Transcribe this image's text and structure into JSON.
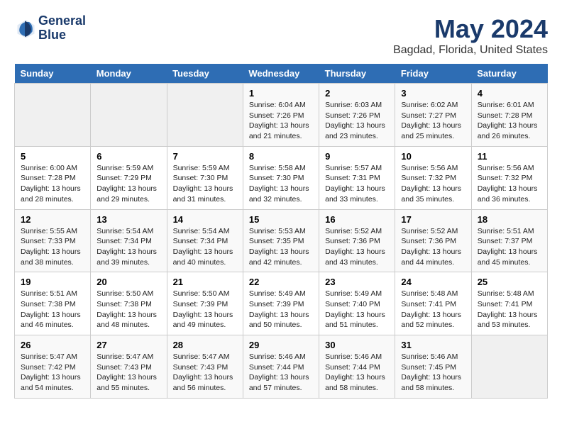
{
  "header": {
    "logo_line1": "General",
    "logo_line2": "Blue",
    "title": "May 2024",
    "subtitle": "Bagdad, Florida, United States"
  },
  "calendar": {
    "days_of_week": [
      "Sunday",
      "Monday",
      "Tuesday",
      "Wednesday",
      "Thursday",
      "Friday",
      "Saturday"
    ],
    "weeks": [
      [
        {
          "day": "",
          "info": ""
        },
        {
          "day": "",
          "info": ""
        },
        {
          "day": "",
          "info": ""
        },
        {
          "day": "1",
          "info": "Sunrise: 6:04 AM\nSunset: 7:26 PM\nDaylight: 13 hours\nand 21 minutes."
        },
        {
          "day": "2",
          "info": "Sunrise: 6:03 AM\nSunset: 7:26 PM\nDaylight: 13 hours\nand 23 minutes."
        },
        {
          "day": "3",
          "info": "Sunrise: 6:02 AM\nSunset: 7:27 PM\nDaylight: 13 hours\nand 25 minutes."
        },
        {
          "day": "4",
          "info": "Sunrise: 6:01 AM\nSunset: 7:28 PM\nDaylight: 13 hours\nand 26 minutes."
        }
      ],
      [
        {
          "day": "5",
          "info": "Sunrise: 6:00 AM\nSunset: 7:28 PM\nDaylight: 13 hours\nand 28 minutes."
        },
        {
          "day": "6",
          "info": "Sunrise: 5:59 AM\nSunset: 7:29 PM\nDaylight: 13 hours\nand 29 minutes."
        },
        {
          "day": "7",
          "info": "Sunrise: 5:59 AM\nSunset: 7:30 PM\nDaylight: 13 hours\nand 31 minutes."
        },
        {
          "day": "8",
          "info": "Sunrise: 5:58 AM\nSunset: 7:30 PM\nDaylight: 13 hours\nand 32 minutes."
        },
        {
          "day": "9",
          "info": "Sunrise: 5:57 AM\nSunset: 7:31 PM\nDaylight: 13 hours\nand 33 minutes."
        },
        {
          "day": "10",
          "info": "Sunrise: 5:56 AM\nSunset: 7:32 PM\nDaylight: 13 hours\nand 35 minutes."
        },
        {
          "day": "11",
          "info": "Sunrise: 5:56 AM\nSunset: 7:32 PM\nDaylight: 13 hours\nand 36 minutes."
        }
      ],
      [
        {
          "day": "12",
          "info": "Sunrise: 5:55 AM\nSunset: 7:33 PM\nDaylight: 13 hours\nand 38 minutes."
        },
        {
          "day": "13",
          "info": "Sunrise: 5:54 AM\nSunset: 7:34 PM\nDaylight: 13 hours\nand 39 minutes."
        },
        {
          "day": "14",
          "info": "Sunrise: 5:54 AM\nSunset: 7:34 PM\nDaylight: 13 hours\nand 40 minutes."
        },
        {
          "day": "15",
          "info": "Sunrise: 5:53 AM\nSunset: 7:35 PM\nDaylight: 13 hours\nand 42 minutes."
        },
        {
          "day": "16",
          "info": "Sunrise: 5:52 AM\nSunset: 7:36 PM\nDaylight: 13 hours\nand 43 minutes."
        },
        {
          "day": "17",
          "info": "Sunrise: 5:52 AM\nSunset: 7:36 PM\nDaylight: 13 hours\nand 44 minutes."
        },
        {
          "day": "18",
          "info": "Sunrise: 5:51 AM\nSunset: 7:37 PM\nDaylight: 13 hours\nand 45 minutes."
        }
      ],
      [
        {
          "day": "19",
          "info": "Sunrise: 5:51 AM\nSunset: 7:38 PM\nDaylight: 13 hours\nand 46 minutes."
        },
        {
          "day": "20",
          "info": "Sunrise: 5:50 AM\nSunset: 7:38 PM\nDaylight: 13 hours\nand 48 minutes."
        },
        {
          "day": "21",
          "info": "Sunrise: 5:50 AM\nSunset: 7:39 PM\nDaylight: 13 hours\nand 49 minutes."
        },
        {
          "day": "22",
          "info": "Sunrise: 5:49 AM\nSunset: 7:39 PM\nDaylight: 13 hours\nand 50 minutes."
        },
        {
          "day": "23",
          "info": "Sunrise: 5:49 AM\nSunset: 7:40 PM\nDaylight: 13 hours\nand 51 minutes."
        },
        {
          "day": "24",
          "info": "Sunrise: 5:48 AM\nSunset: 7:41 PM\nDaylight: 13 hours\nand 52 minutes."
        },
        {
          "day": "25",
          "info": "Sunrise: 5:48 AM\nSunset: 7:41 PM\nDaylight: 13 hours\nand 53 minutes."
        }
      ],
      [
        {
          "day": "26",
          "info": "Sunrise: 5:47 AM\nSunset: 7:42 PM\nDaylight: 13 hours\nand 54 minutes."
        },
        {
          "day": "27",
          "info": "Sunrise: 5:47 AM\nSunset: 7:43 PM\nDaylight: 13 hours\nand 55 minutes."
        },
        {
          "day": "28",
          "info": "Sunrise: 5:47 AM\nSunset: 7:43 PM\nDaylight: 13 hours\nand 56 minutes."
        },
        {
          "day": "29",
          "info": "Sunrise: 5:46 AM\nSunset: 7:44 PM\nDaylight: 13 hours\nand 57 minutes."
        },
        {
          "day": "30",
          "info": "Sunrise: 5:46 AM\nSunset: 7:44 PM\nDaylight: 13 hours\nand 58 minutes."
        },
        {
          "day": "31",
          "info": "Sunrise: 5:46 AM\nSunset: 7:45 PM\nDaylight: 13 hours\nand 58 minutes."
        },
        {
          "day": "",
          "info": ""
        }
      ]
    ]
  }
}
